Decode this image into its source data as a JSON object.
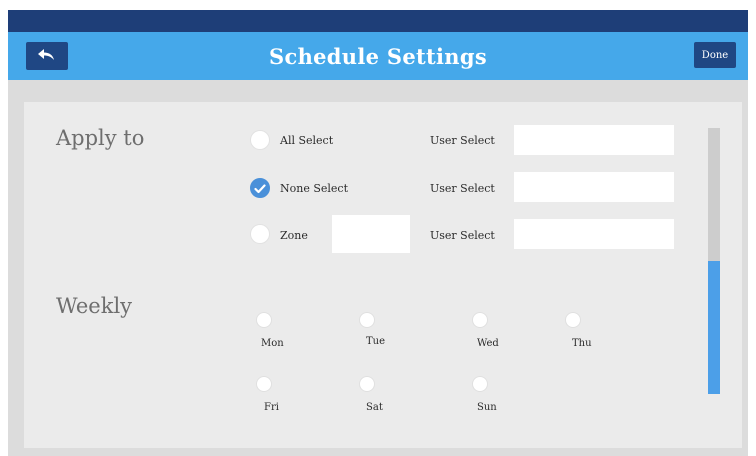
{
  "header": {
    "title": "Schedule Settings",
    "back_icon": "undo-arrow-icon",
    "done_label": "Done"
  },
  "apply_to": {
    "label": "Apply to",
    "options": [
      {
        "label": "All Select",
        "checked": false
      },
      {
        "label": "None Select",
        "checked": true
      },
      {
        "label": "Zone",
        "checked": false
      }
    ],
    "zone_value": "",
    "user_select_label": "User Select",
    "user_select_values": [
      "",
      "",
      ""
    ]
  },
  "weekly": {
    "label": "Weekly",
    "days": [
      "Mon",
      "Tue",
      "Wed",
      "Thu",
      "Fri",
      "Sat",
      "Sun"
    ]
  },
  "colors": {
    "status_bar": "#1e3e78",
    "header": "#45a8ea",
    "button": "#1f4784",
    "accent": "#4a90d9",
    "scroll_thumb": "#4c9fe8"
  }
}
